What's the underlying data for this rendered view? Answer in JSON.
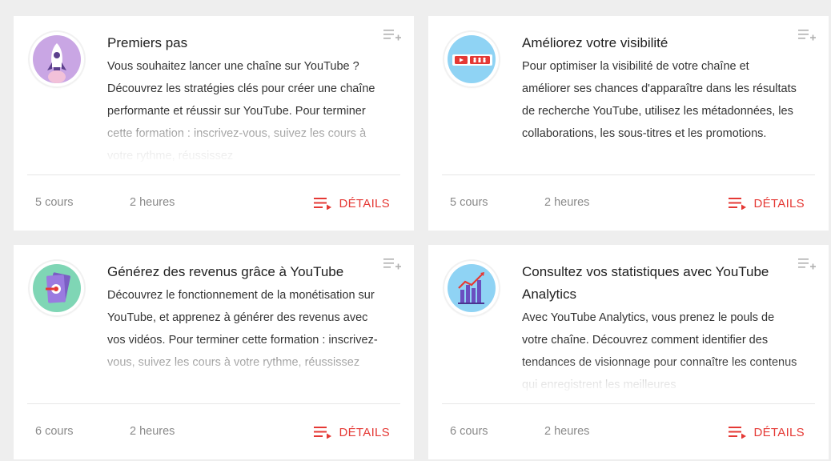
{
  "cards": [
    {
      "title": "Premiers pas",
      "description": "Vous souhaitez lancer une chaîne sur YouTube ? Découvrez les stratégies clés pour créer une chaîne performante et réussir sur YouTube. Pour terminer cette formation : inscrivez-vous, suivez les cours à votre rythme, réussissez",
      "courses": "5 cours",
      "duration": "2 heures",
      "details_label": "DÉTAILS",
      "icon": "rocket-icon",
      "icon_bg": "#c9a6e4"
    },
    {
      "title": "Améliorez votre visibilité",
      "description": "Pour optimiser la visibilité de votre chaîne et améliorer ses chances d'apparaître dans les résultats de recherche YouTube, utilisez les métadonnées, les collaborations, les sous-titres et les promotions.",
      "courses": "5 cours",
      "duration": "2 heures",
      "details_label": "DÉTAILS",
      "icon": "video-tags-icon",
      "icon_bg": "#8fd3f4"
    },
    {
      "title": "Générez des revenus grâce à YouTube",
      "description": "Découvrez le fonctionnement de la monétisation sur YouTube, et apprenez à générer des revenus avec vos vidéos. Pour terminer cette formation : inscrivez-vous, suivez les cours à votre rythme, réussissez",
      "courses": "6 cours",
      "duration": "2 heures",
      "details_label": "DÉTAILS",
      "icon": "money-icon",
      "icon_bg": "#7fd6b5"
    },
    {
      "title": "Consultez vos statistiques avec YouTube Analytics",
      "description": "Avec YouTube Analytics, vous prenez le pouls de votre chaîne. Découvrez comment identifier des tendances de visionnage pour connaître les contenus qui enregistrent les meilleures",
      "courses": "6 cours",
      "duration": "2 heures",
      "details_label": "DÉTAILS",
      "icon": "bar-chart-icon",
      "icon_bg": "#8fd3f4"
    }
  ],
  "colors": {
    "accent": "#e53935",
    "page_bg": "#eeeeee",
    "muted_text": "#8a8a8a"
  }
}
